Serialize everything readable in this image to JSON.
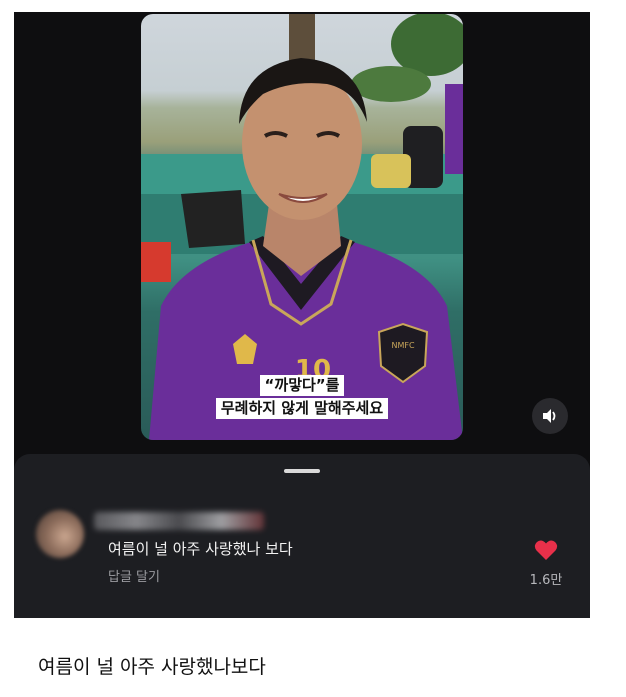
{
  "video": {
    "caption_line1": "“까맣다”를",
    "caption_line2": "무례하지 않게 말해주세요",
    "jersey_badge": "NMFC",
    "jersey_number": "10"
  },
  "comment": {
    "text": "여름이 널 아주 사랑했나 보다",
    "reply_label": "답글 달기",
    "like_count": "1.6만"
  },
  "post_caption": "여름이 널 아주 사랑했나보다",
  "colors": {
    "screen_bg": "#0e0e10",
    "sheet_bg": "#1d1e22",
    "like_heart": "#e8304a",
    "jersey": "#6a2e9a"
  },
  "icons": {
    "volume": "speaker-icon",
    "like": "heart-icon"
  }
}
